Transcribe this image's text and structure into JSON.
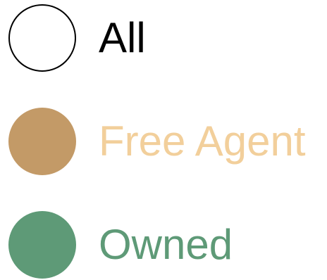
{
  "filter_options": [
    {
      "label": "All",
      "dot_fill": "#ffffff",
      "dot_stroke": "#000000",
      "text_color": "#000000"
    },
    {
      "label": "Free Agent",
      "dot_fill": "#c39a67",
      "dot_stroke": "#c39a67",
      "text_color": "#f2cf9b"
    },
    {
      "label": "Owned",
      "dot_fill": "#5e9a77",
      "dot_stroke": "#5e9a77",
      "text_color": "#5e9a77"
    }
  ]
}
